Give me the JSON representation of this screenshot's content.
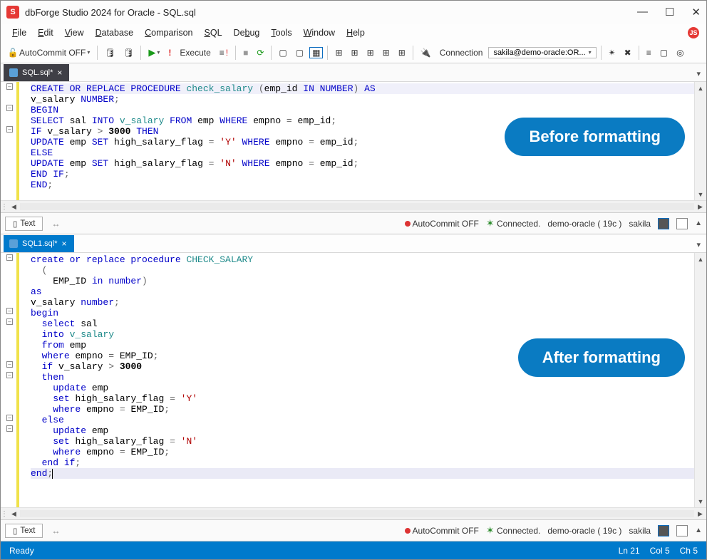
{
  "title": "dbForge Studio 2024 for Oracle - SQL.sql",
  "menu": [
    "File",
    "Edit",
    "View",
    "Database",
    "Comparison",
    "SQL",
    "Debug",
    "Tools",
    "Window",
    "Help"
  ],
  "toolbar": {
    "autocommit": "AutoCommit OFF",
    "execute": "Execute",
    "connection_label": "Connection",
    "connection_value": "sakila@demo-oracle:OR..."
  },
  "tabs": {
    "pane1": "SQL.sql*",
    "pane2": "SQL1.sql*"
  },
  "badges": {
    "before": "Before formatting",
    "after": "After formatting"
  },
  "status_pane": {
    "text_btn": "Text",
    "autocommit": "AutoCommit OFF",
    "connected": "Connected.",
    "server": "demo-oracle ( 19c )",
    "schema": "sakila"
  },
  "statusbar": {
    "ready": "Ready",
    "ln": "Ln 21",
    "col": "Col 5",
    "ch": "Ch 5"
  },
  "code_before": [
    {
      "hl": true,
      "tokens": [
        [
          "kw",
          "CREATE OR REPLACE PROCEDURE "
        ],
        [
          "fn",
          "check_salary "
        ],
        [
          "op",
          "("
        ],
        [
          "",
          "emp_id "
        ],
        [
          "kw",
          "IN NUMBER"
        ],
        [
          "op",
          ") "
        ],
        [
          "kw",
          "AS"
        ]
      ]
    },
    {
      "tokens": [
        [
          "",
          "v_salary "
        ],
        [
          "kw",
          "NUMBER"
        ],
        [
          "op",
          ";"
        ]
      ]
    },
    {
      "tokens": [
        [
          "kw",
          "BEGIN"
        ]
      ]
    },
    {
      "tokens": [
        [
          "kw",
          "SELECT "
        ],
        [
          "",
          "sal "
        ],
        [
          "kw",
          "INTO "
        ],
        [
          "fn",
          "v_salary "
        ],
        [
          "kw",
          "FROM "
        ],
        [
          "",
          "emp "
        ],
        [
          "kw",
          "WHERE "
        ],
        [
          "",
          "empno "
        ],
        [
          "op",
          "= "
        ],
        [
          "",
          "emp_id"
        ],
        [
          "op",
          ";"
        ]
      ]
    },
    {
      "tokens": [
        [
          "kw",
          "IF "
        ],
        [
          "",
          "v_salary "
        ],
        [
          "op",
          "> "
        ],
        [
          "num",
          "3000 "
        ],
        [
          "kw",
          "THEN"
        ]
      ]
    },
    {
      "tokens": [
        [
          "kw",
          "UPDATE "
        ],
        [
          "",
          "emp "
        ],
        [
          "kw",
          "SET "
        ],
        [
          "",
          "high_salary_flag "
        ],
        [
          "op",
          "= "
        ],
        [
          "str",
          "'Y' "
        ],
        [
          "kw",
          "WHERE "
        ],
        [
          "",
          "empno "
        ],
        [
          "op",
          "= "
        ],
        [
          "",
          "emp_id"
        ],
        [
          "op",
          ";"
        ]
      ]
    },
    {
      "tokens": [
        [
          "kw",
          "ELSE"
        ]
      ]
    },
    {
      "tokens": [
        [
          "kw",
          "UPDATE "
        ],
        [
          "",
          "emp "
        ],
        [
          "kw",
          "SET "
        ],
        [
          "",
          "high_salary_flag "
        ],
        [
          "op",
          "= "
        ],
        [
          "str",
          "'N' "
        ],
        [
          "kw",
          "WHERE "
        ],
        [
          "",
          "empno "
        ],
        [
          "op",
          "= "
        ],
        [
          "",
          "emp_id"
        ],
        [
          "op",
          ";"
        ]
      ]
    },
    {
      "tokens": [
        [
          "kw",
          "END IF"
        ],
        [
          "op",
          ";"
        ]
      ]
    },
    {
      "tokens": [
        [
          "kw",
          "END"
        ],
        [
          "op",
          ";"
        ]
      ]
    }
  ],
  "code_after": [
    {
      "tokens": [
        [
          "kw",
          "create or replace procedure "
        ],
        [
          "fn",
          "CHECK_SALARY"
        ]
      ]
    },
    {
      "tokens": [
        [
          "",
          "  "
        ],
        [
          "op",
          "("
        ]
      ]
    },
    {
      "tokens": [
        [
          "",
          "    EMP_ID "
        ],
        [
          "kw",
          "in number"
        ],
        [
          "op",
          ")"
        ]
      ]
    },
    {
      "tokens": [
        [
          "kw",
          "as"
        ]
      ]
    },
    {
      "tokens": [
        [
          "",
          "v_salary "
        ],
        [
          "kw",
          "number"
        ],
        [
          "op",
          ";"
        ]
      ]
    },
    {
      "tokens": [
        [
          "kw",
          "begin"
        ]
      ]
    },
    {
      "tokens": [
        [
          "",
          "  "
        ],
        [
          "kw",
          "select "
        ],
        [
          "",
          "sal"
        ]
      ]
    },
    {
      "tokens": [
        [
          "",
          "  "
        ],
        [
          "kw",
          "into "
        ],
        [
          "fn",
          "v_salary"
        ]
      ]
    },
    {
      "tokens": [
        [
          "",
          "  "
        ],
        [
          "kw",
          "from "
        ],
        [
          "",
          "emp"
        ]
      ]
    },
    {
      "tokens": [
        [
          "",
          "  "
        ],
        [
          "kw",
          "where "
        ],
        [
          "",
          "empno "
        ],
        [
          "op",
          "= "
        ],
        [
          "",
          "EMP_ID"
        ],
        [
          "op",
          ";"
        ]
      ]
    },
    {
      "tokens": [
        [
          "",
          "  "
        ],
        [
          "kw",
          "if "
        ],
        [
          "",
          "v_salary "
        ],
        [
          "op",
          "> "
        ],
        [
          "num",
          "3000"
        ]
      ]
    },
    {
      "tokens": [
        [
          "",
          "  "
        ],
        [
          "kw",
          "then"
        ]
      ]
    },
    {
      "tokens": [
        [
          "",
          "    "
        ],
        [
          "kw",
          "update "
        ],
        [
          "",
          "emp"
        ]
      ]
    },
    {
      "tokens": [
        [
          "",
          "    "
        ],
        [
          "kw",
          "set "
        ],
        [
          "",
          "high_salary_flag "
        ],
        [
          "op",
          "= "
        ],
        [
          "str",
          "'Y'"
        ]
      ]
    },
    {
      "tokens": [
        [
          "",
          "    "
        ],
        [
          "kw",
          "where "
        ],
        [
          "",
          "empno "
        ],
        [
          "op",
          "= "
        ],
        [
          "",
          "EMP_ID"
        ],
        [
          "op",
          ";"
        ]
      ]
    },
    {
      "tokens": [
        [
          "",
          "  "
        ],
        [
          "kw",
          "else"
        ]
      ]
    },
    {
      "tokens": [
        [
          "",
          "    "
        ],
        [
          "kw",
          "update "
        ],
        [
          "",
          "emp"
        ]
      ]
    },
    {
      "tokens": [
        [
          "",
          "    "
        ],
        [
          "kw",
          "set "
        ],
        [
          "",
          "high_salary_flag "
        ],
        [
          "op",
          "= "
        ],
        [
          "str",
          "'N'"
        ]
      ]
    },
    {
      "tokens": [
        [
          "",
          "    "
        ],
        [
          "kw",
          "where "
        ],
        [
          "",
          "empno "
        ],
        [
          "op",
          "= "
        ],
        [
          "",
          "EMP_ID"
        ],
        [
          "op",
          ";"
        ]
      ]
    },
    {
      "tokens": [
        [
          "",
          "  "
        ],
        [
          "kw",
          "end if"
        ],
        [
          "op",
          ";"
        ]
      ]
    },
    {
      "hl": "last",
      "tokens": [
        [
          "kw",
          "end"
        ],
        [
          "op",
          ";"
        ],
        [
          "cursor",
          ""
        ]
      ]
    }
  ]
}
